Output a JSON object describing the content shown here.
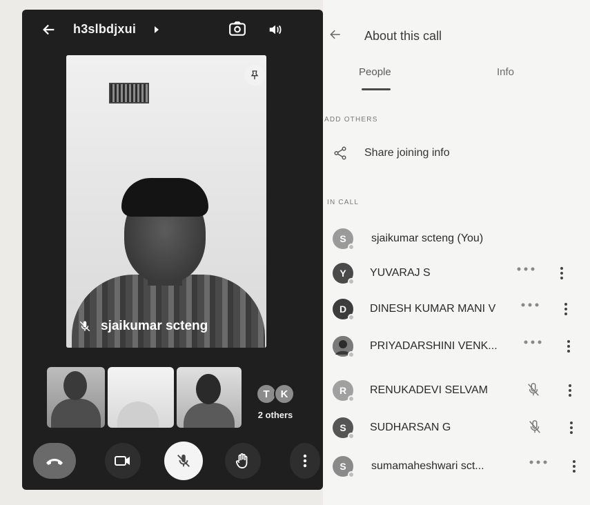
{
  "call": {
    "meeting_code": "h3slbdjxui",
    "main_speaker": "sjaikumar scteng",
    "others_avatars": [
      "T",
      "K"
    ],
    "others_label": "2 others"
  },
  "panel": {
    "title": "About this call",
    "tabs": [
      {
        "label": "People",
        "active": true
      },
      {
        "label": "Info",
        "active": false
      }
    ],
    "add_others_header": "ADD OTHERS",
    "share_label": "Share joining info",
    "in_call_header": "IN CALL",
    "participants": [
      {
        "initial": "S",
        "name": "sjaikumar scteng (You)",
        "status": "none",
        "color": "#9a9a9a"
      },
      {
        "initial": "Y",
        "name": "YUVARAJ S",
        "status": "dots",
        "color": "#4a4a4a"
      },
      {
        "initial": "D",
        "name": "DINESH KUMAR MANI V",
        "status": "dots",
        "color": "#3c3c3c"
      },
      {
        "initial": "",
        "name": "PRIYADARSHINI VENK...",
        "status": "dots",
        "color": "#6f6f6f"
      },
      {
        "initial": "R",
        "name": "RENUKADEVI SELVAM",
        "status": "muted",
        "color": "#a0a0a0"
      },
      {
        "initial": "S",
        "name": "SUDHARSAN G",
        "status": "muted",
        "color": "#555555"
      },
      {
        "initial": "S",
        "name": "sumamaheshwari sct...",
        "status": "dots",
        "color": "#8a8a8a"
      }
    ]
  }
}
